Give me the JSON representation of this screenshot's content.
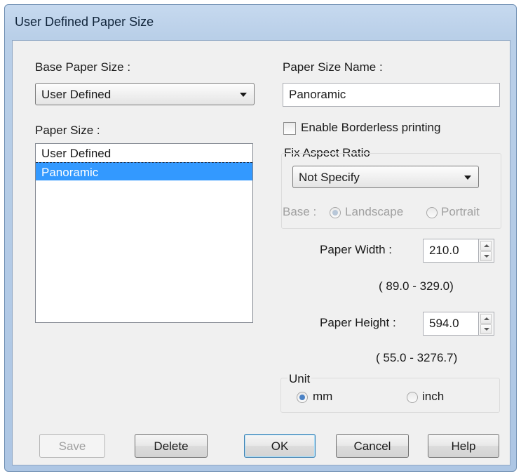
{
  "window": {
    "title": "User Defined Paper Size"
  },
  "base_paper_size": {
    "label": "Base Paper Size :",
    "selected": "User Defined"
  },
  "paper_size_name": {
    "label": "Paper Size Name :",
    "value": "Panoramic"
  },
  "paper_size_list": {
    "label": "Paper Size :",
    "items": [
      "User Defined",
      "Panoramic"
    ],
    "selected_index": 1
  },
  "borderless": {
    "label": "Enable Borderless printing",
    "checked": false
  },
  "aspect_ratio": {
    "label": "Fix Aspect Ratio",
    "selected": "Not Specify",
    "base_label": "Base :",
    "landscape_label": "Landscape",
    "portrait_label": "Portrait",
    "landscape_selected": true
  },
  "paper_width": {
    "label": "Paper Width :",
    "value": "210.0",
    "range": "( 89.0 - 329.0)"
  },
  "paper_height": {
    "label": "Paper Height :",
    "value": "594.0",
    "range": "( 55.0 - 3276.7)"
  },
  "unit": {
    "label": "Unit",
    "mm_label": "mm",
    "inch_label": "inch",
    "selected": "mm"
  },
  "buttons": {
    "save": "Save",
    "delete": "Delete",
    "ok": "OK",
    "cancel": "Cancel",
    "help": "Help"
  },
  "colors": {
    "selection": "#3399ff",
    "title_bar": "#b9cfe8",
    "radio_on": "#4b82c5"
  }
}
